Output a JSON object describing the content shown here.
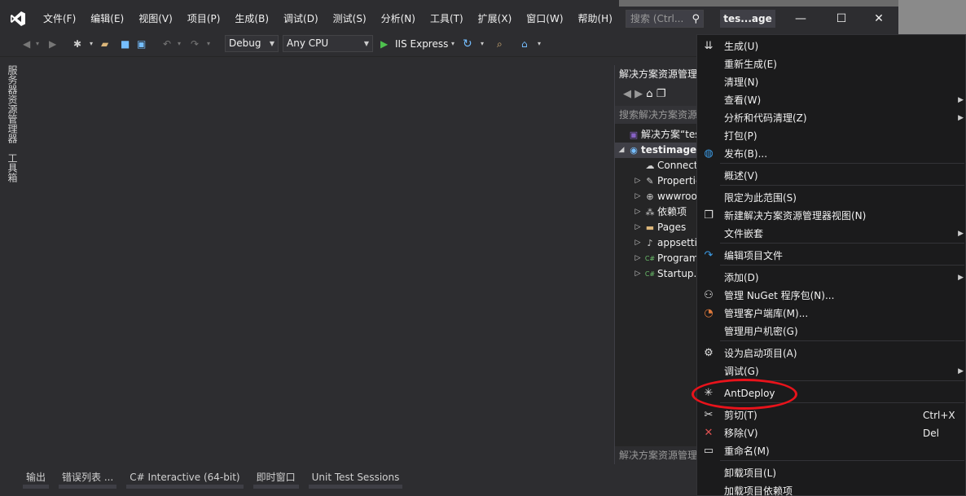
{
  "menubar": {
    "items": [
      "文件(F)",
      "编辑(E)",
      "视图(V)",
      "项目(P)",
      "生成(B)",
      "调试(D)",
      "测试(S)",
      "分析(N)",
      "工具(T)",
      "扩展(X)",
      "窗口(W)",
      "帮助(H)"
    ],
    "search_placeholder": "搜索 (Ctrl...",
    "project_name": "tes...age",
    "minimize": "—",
    "maximize": "☐",
    "close": "✕"
  },
  "toolbar": {
    "config": "Debug",
    "platform": "Any CPU",
    "run_target": "IIS Express"
  },
  "side_tabs": {
    "server_explorer": "服务器资源管理器",
    "toolbox": "工具箱"
  },
  "solution_explorer": {
    "title": "解决方案资源管理器",
    "search_placeholder": "搜索解决方案资源管理器",
    "footer": "解决方案资源管理器",
    "tree": [
      {
        "label": "解决方案“testimage”",
        "icon": "solution-icon",
        "indent": 0,
        "expander": ""
      },
      {
        "label": "testimage",
        "icon": "web-project-icon",
        "indent": 0,
        "expander": "◢",
        "selected": true
      },
      {
        "label": "Connected Services",
        "icon": "connected-services-icon",
        "indent": 1,
        "expander": ""
      },
      {
        "label": "Properties",
        "icon": "wrench-icon",
        "indent": 1,
        "expander": "▷"
      },
      {
        "label": "wwwroot",
        "icon": "globe-icon",
        "indent": 1,
        "expander": "▷"
      },
      {
        "label": "依赖项",
        "icon": "dependencies-icon",
        "indent": 1,
        "expander": "▷"
      },
      {
        "label": "Pages",
        "icon": "folder-icon",
        "indent": 1,
        "expander": "▷"
      },
      {
        "label": "appsettings.json",
        "icon": "json-file-icon",
        "indent": 1,
        "expander": "▷"
      },
      {
        "label": "Program.cs",
        "icon": "csharp-file-icon",
        "indent": 1,
        "expander": "▷"
      },
      {
        "label": "Startup.cs",
        "icon": "csharp-file-icon",
        "indent": 1,
        "expander": "▷"
      }
    ]
  },
  "bottom_tabs": [
    "输出",
    "错误列表 ...",
    "C# Interactive (64-bit)",
    "即时窗口",
    "Unit Test Sessions"
  ],
  "context_menu": {
    "items": [
      {
        "label": "生成(U)",
        "icon": "build-icon",
        "shortcut": "",
        "submenu": false
      },
      {
        "label": "重新生成(E)",
        "icon": "",
        "shortcut": "",
        "submenu": false
      },
      {
        "label": "清理(N)",
        "icon": "",
        "shortcut": "",
        "submenu": false
      },
      {
        "label": "查看(W)",
        "icon": "",
        "shortcut": "",
        "submenu": true
      },
      {
        "label": "分析和代码清理(Z)",
        "icon": "",
        "shortcut": "",
        "submenu": true
      },
      {
        "label": "打包(P)",
        "icon": "",
        "shortcut": "",
        "submenu": false
      },
      {
        "label": "发布(B)...",
        "icon": "publish-globe-icon",
        "shortcut": "",
        "submenu": false
      },
      {
        "label": "概述(V)",
        "icon": "",
        "shortcut": "",
        "submenu": false
      },
      {
        "label": "限定为此范围(S)",
        "icon": "",
        "shortcut": "",
        "submenu": false
      },
      {
        "label": "新建解决方案资源管理器视图(N)",
        "icon": "new-view-icon",
        "shortcut": "",
        "submenu": false
      },
      {
        "label": "文件嵌套",
        "icon": "",
        "shortcut": "",
        "submenu": true
      },
      {
        "label": "编辑项目文件",
        "icon": "edit-arrow-icon",
        "shortcut": "",
        "submenu": false
      },
      {
        "label": "添加(D)",
        "icon": "",
        "shortcut": "",
        "submenu": true
      },
      {
        "label": "管理 NuGet 程序包(N)...",
        "icon": "nuget-icon",
        "shortcut": "",
        "submenu": false
      },
      {
        "label": "管理客户端库(M)...",
        "icon": "client-library-icon",
        "shortcut": "",
        "submenu": false
      },
      {
        "label": "管理用户机密(G)",
        "icon": "",
        "shortcut": "",
        "submenu": false
      },
      {
        "label": "设为启动项目(A)",
        "icon": "gear-icon",
        "shortcut": "",
        "submenu": false
      },
      {
        "label": "调试(G)",
        "icon": "",
        "shortcut": "",
        "submenu": true
      },
      {
        "label": "AntDeploy",
        "icon": "ant-icon",
        "shortcut": "",
        "submenu": false
      },
      {
        "label": "剪切(T)",
        "icon": "scissors-icon",
        "shortcut": "Ctrl+X",
        "submenu": false
      },
      {
        "label": "移除(V)",
        "icon": "remove-x-icon",
        "shortcut": "Del",
        "submenu": false
      },
      {
        "label": "重命名(M)",
        "icon": "rename-icon",
        "shortcut": "",
        "submenu": false
      },
      {
        "label": "卸载项目(L)",
        "icon": "",
        "shortcut": "",
        "submenu": false
      },
      {
        "label": "加载项目依赖项",
        "icon": "",
        "shortcut": "",
        "submenu": false
      }
    ]
  },
  "colors": {
    "background": "#2d2d30",
    "menu_background": "#1b1b1c",
    "annotation": "#e8131b",
    "vs_purple": "#8661c5"
  }
}
